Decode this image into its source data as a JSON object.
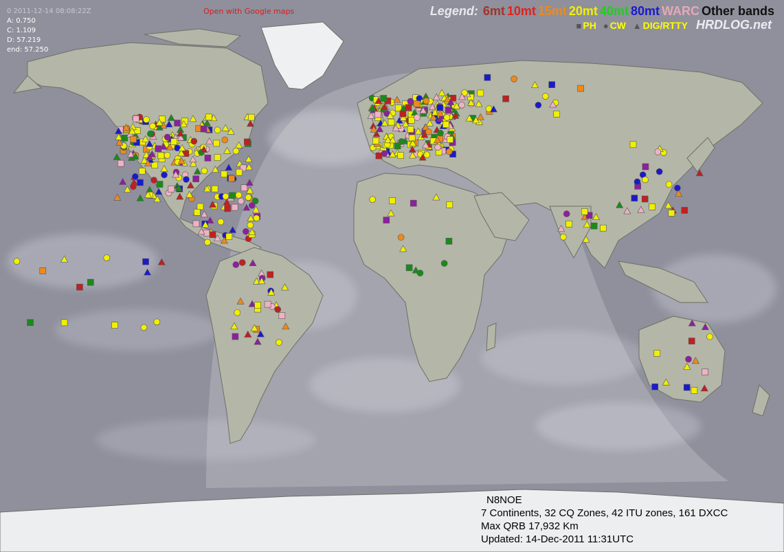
{
  "info": {
    "timestamp": "0 2011-12-14 08:08:22Z",
    "line_a": "A: 0.750",
    "line_c": "C: 1.109",
    "line_d": "D: 57.219",
    "line_end": "end: 57.250"
  },
  "google_link": "Open with Google maps",
  "legend": {
    "title": "Legend:",
    "bands": [
      {
        "label": "6mt",
        "color": "#a0332b"
      },
      {
        "label": "10mt",
        "color": "#e0221c"
      },
      {
        "label": "15mt",
        "color": "#ee8a1a"
      },
      {
        "label": "20mt",
        "color": "#f0f000"
      },
      {
        "label": "40mt",
        "color": "#22cc22"
      },
      {
        "label": "80mt",
        "color": "#1a1acc"
      },
      {
        "label": "WARC",
        "color": "#e6a8b8"
      },
      {
        "label": "Other bands",
        "color": "#111111"
      }
    ],
    "modes": [
      {
        "label": "PH",
        "icon": "square-icon"
      },
      {
        "label": "CW",
        "icon": "circle-icon"
      },
      {
        "label": "DIG/RTTY",
        "icon": "triangle-icon"
      }
    ]
  },
  "brand": "HRDLOG.net",
  "stats": {
    "callsign": "N8NOE",
    "summary": "7 Continents, 32 CQ Zones, 42 ITU zones, 161 DXCC",
    "max_qrb": "Max QRB 17,932 Km",
    "updated": "Updated: 14-Dec-2011 11:31UTC"
  },
  "colors": {
    "yellow": "#f0f000",
    "green": "#1a8a1a",
    "blue": "#1a1acc",
    "orange": "#ee8a1a",
    "pink": "#f2b0c4",
    "red": "#c02020",
    "purple": "#8e1f9e",
    "darkred": "#a0332b"
  }
}
